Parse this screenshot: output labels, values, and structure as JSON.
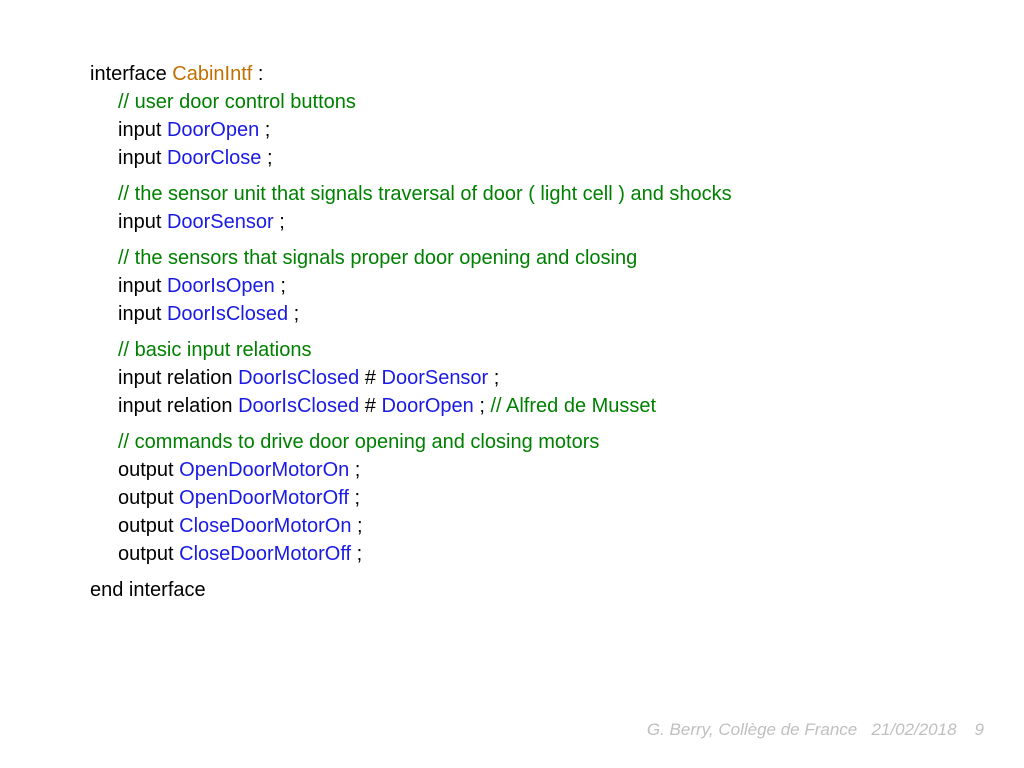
{
  "header": {
    "kw_interface": "interface",
    "type_name": "CabinIntf",
    "colon": " :"
  },
  "blocks": [
    {
      "comment": "// user door control buttons",
      "lines": [
        {
          "prefix": "input ",
          "ident": "DoorOpen",
          "suffix": " ;"
        },
        {
          "prefix": "input ",
          "ident": "DoorClose",
          "suffix": " ;"
        }
      ]
    },
    {
      "comment": "// the sensor unit that signals traversal of door ( light cell ) and shocks",
      "lines": [
        {
          "prefix": "input ",
          "ident": "DoorSensor",
          "suffix": " ;"
        }
      ]
    },
    {
      "comment": "// the sensors that signals proper door opening and closing",
      "lines": [
        {
          "prefix": "input ",
          "ident": "DoorIsOpen",
          "suffix": " ;"
        },
        {
          "prefix": "input ",
          "ident": "DoorIsClosed",
          "suffix": " ;"
        }
      ]
    },
    {
      "comment": "// basic input relations",
      "rel_lines": [
        {
          "prefix": "input relation ",
          "ident1": "DoorIsClosed",
          "mid": " # ",
          "ident2": "DoorSensor",
          "suffix": " ;",
          "trail_comment": ""
        },
        {
          "prefix": "input relation ",
          "ident1": "DoorIsClosed",
          "mid": " # ",
          "ident2": "DoorOpen",
          "suffix": " ; ",
          "trail_comment": "// Alfred de Musset"
        }
      ]
    },
    {
      "comment": "// commands to drive door opening and closing motors",
      "lines": [
        {
          "prefix": "output ",
          "ident": "OpenDoorMotorOn",
          "suffix": " ;"
        },
        {
          "prefix": "output ",
          "ident": "OpenDoorMotorOff",
          "suffix": " ;"
        },
        {
          "prefix": "output ",
          "ident": "CloseDoorMotorOn",
          "suffix": " ;"
        },
        {
          "prefix": "output ",
          "ident": "CloseDoorMotorOff",
          "suffix": " ;"
        }
      ]
    }
  ],
  "footer_line": "end interface",
  "footer": {
    "author": "G. Berry, Collège de France",
    "date": "21/02/2018",
    "page": "9"
  }
}
